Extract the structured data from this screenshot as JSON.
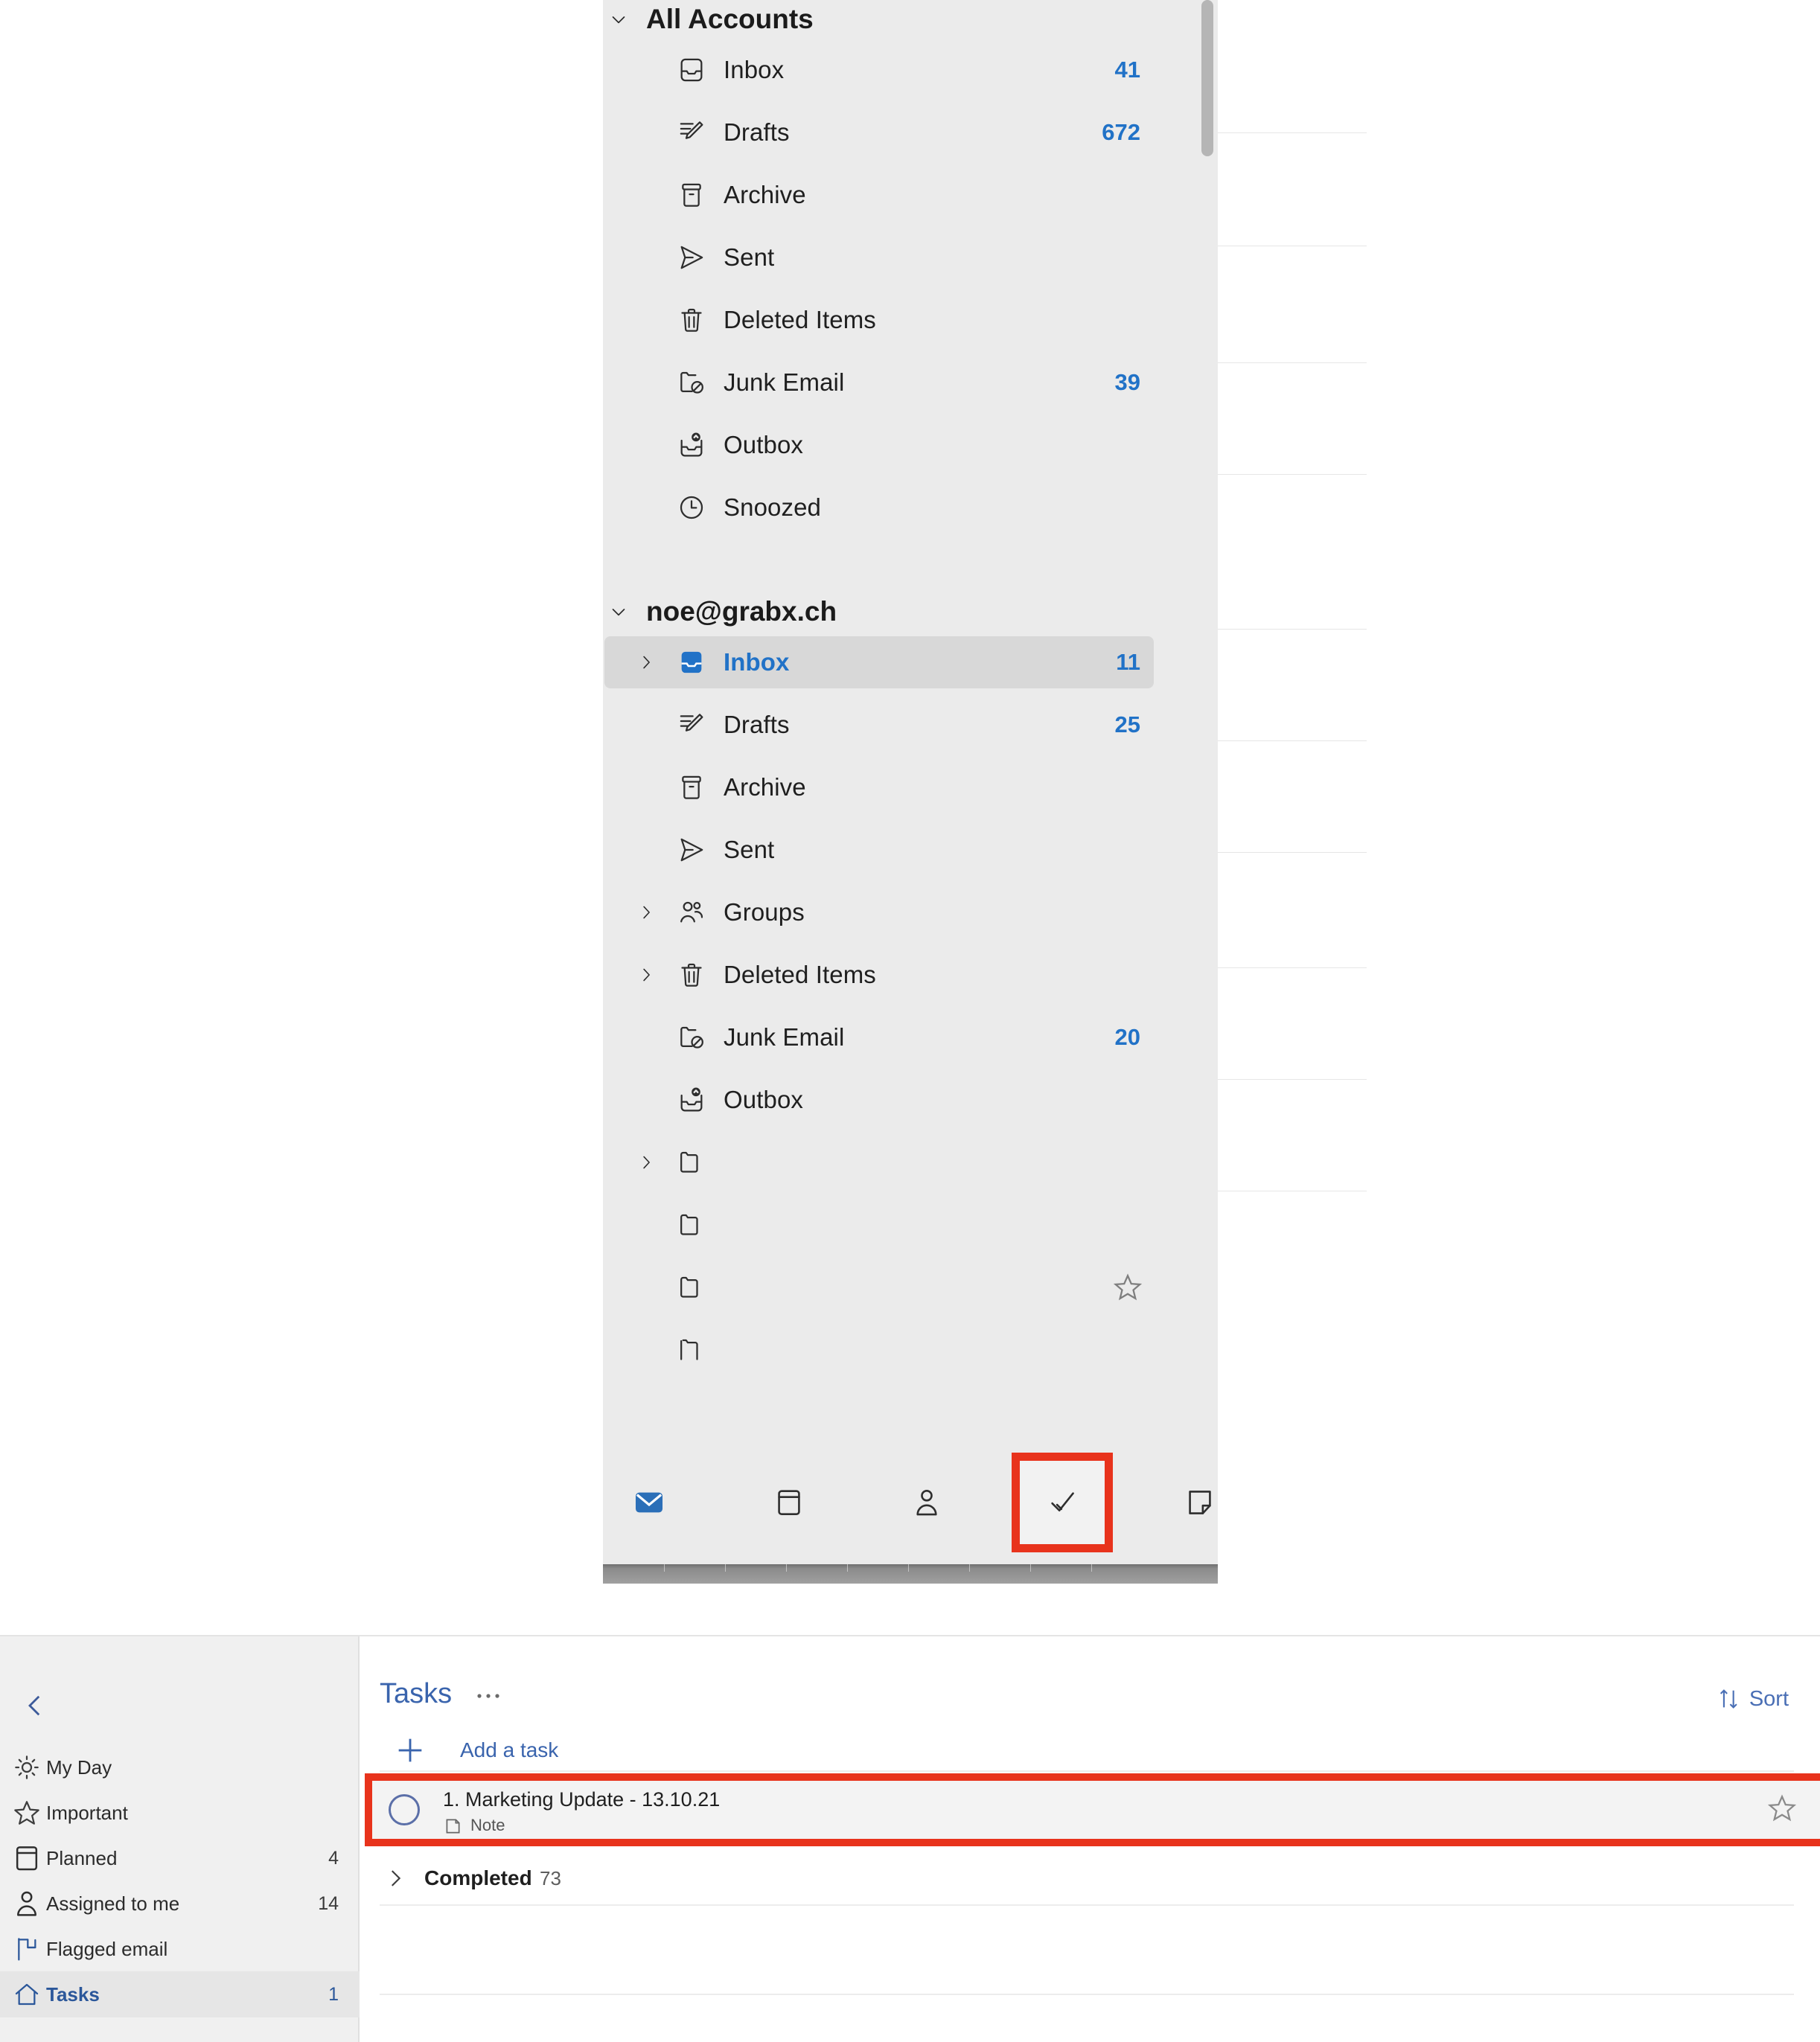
{
  "mail": {
    "accounts": [
      {
        "name": "All Accounts",
        "expand_icon": "chevron-down-icon",
        "folders": [
          {
            "label": "Inbox",
            "icon": "inbox-icon",
            "count": "41",
            "expander": false,
            "selected": false
          },
          {
            "label": "Drafts",
            "icon": "drafts-pencil-icon",
            "count": "672",
            "expander": false,
            "selected": false
          },
          {
            "label": "Archive",
            "icon": "archive-box-icon",
            "count": "",
            "expander": false,
            "selected": false
          },
          {
            "label": "Sent",
            "icon": "sent-paperplane-icon",
            "count": "",
            "expander": false,
            "selected": false
          },
          {
            "label": "Deleted Items",
            "icon": "trash-icon",
            "count": "",
            "expander": false,
            "selected": false
          },
          {
            "label": "Junk Email",
            "icon": "junk-folder-blocked-icon",
            "count": "39",
            "expander": false,
            "selected": false
          },
          {
            "label": "Outbox",
            "icon": "outbox-upload-icon",
            "count": "",
            "expander": false,
            "selected": false
          },
          {
            "label": "Snoozed",
            "icon": "clock-icon",
            "count": "",
            "expander": false,
            "selected": false
          }
        ]
      },
      {
        "name": "noe@grabx.ch",
        "expand_icon": "chevron-down-icon",
        "folders": [
          {
            "label": "Inbox",
            "icon": "inbox-filled-icon",
            "count": "11",
            "expander": true,
            "selected": true
          },
          {
            "label": "Drafts",
            "icon": "drafts-pencil-icon",
            "count": "25",
            "expander": false,
            "selected": false
          },
          {
            "label": "Archive",
            "icon": "archive-box-icon",
            "count": "",
            "expander": false,
            "selected": false
          },
          {
            "label": "Sent",
            "icon": "sent-paperplane-icon",
            "count": "",
            "expander": false,
            "selected": false
          },
          {
            "label": "Groups",
            "icon": "people-group-icon",
            "count": "",
            "expander": true,
            "selected": false
          },
          {
            "label": "Deleted Items",
            "icon": "trash-icon",
            "count": "",
            "expander": true,
            "selected": false
          },
          {
            "label": "Junk Email",
            "icon": "junk-folder-blocked-icon",
            "count": "20",
            "expander": false,
            "selected": false
          },
          {
            "label": "Outbox",
            "icon": "outbox-upload-icon",
            "count": "",
            "expander": false,
            "selected": false
          },
          {
            "label": "",
            "icon": "folder-icon",
            "count": "",
            "expander": true,
            "selected": false
          },
          {
            "label": "",
            "icon": "folder-icon",
            "count": "",
            "expander": false,
            "selected": false
          },
          {
            "label": "",
            "icon": "folder-icon",
            "count": "",
            "expander": false,
            "selected": false,
            "star": true
          },
          {
            "label": "",
            "icon": "folder-partial-icon",
            "count": "",
            "expander": false,
            "selected": false
          }
        ]
      }
    ],
    "appbar": [
      {
        "name": "mail-app-button",
        "icon": "mail-filled-icon",
        "active": true,
        "highlighted": false
      },
      {
        "name": "calendar-app-button",
        "icon": "calendar-icon",
        "active": false,
        "highlighted": false
      },
      {
        "name": "people-app-button",
        "icon": "person-icon",
        "active": false,
        "highlighted": false
      },
      {
        "name": "tasks-app-button",
        "icon": "checkmark-icon",
        "active": false,
        "highlighted": true
      },
      {
        "name": "notes-app-button",
        "icon": "note-icon",
        "active": false,
        "highlighted": false
      }
    ]
  },
  "tasks": {
    "sidebar": {
      "back_icon": "chevron-left-icon",
      "items": [
        {
          "label": "My Day",
          "icon": "sun-icon",
          "count": "",
          "active": false
        },
        {
          "label": "Important",
          "icon": "star-icon",
          "count": "",
          "active": false
        },
        {
          "label": "Planned",
          "icon": "calendar-icon",
          "count": "4",
          "active": false
        },
        {
          "label": "Assigned to me",
          "icon": "person-icon",
          "count": "14",
          "active": false
        },
        {
          "label": "Flagged email",
          "icon": "flag-icon",
          "count": "",
          "active": false
        },
        {
          "label": "Tasks",
          "icon": "home-icon",
          "count": "1",
          "active": true
        }
      ]
    },
    "main": {
      "title": "Tasks",
      "more_icon": "ellipsis-icon",
      "sort_label": "Sort",
      "sort_icon": "sort-arrows-icon",
      "add_task_label": "Add a task",
      "add_task_icon": "plus-icon",
      "task": {
        "title": "1. Marketing Update - 13.10.21",
        "note_label": "Note",
        "note_icon": "note-small-icon",
        "complete_icon": "circle-icon",
        "star_icon": "star-outline-icon"
      },
      "completed": {
        "label": "Completed",
        "count": "73",
        "expand_icon": "chevron-right-icon"
      }
    }
  },
  "colors": {
    "accent_blue": "#2172c7",
    "link_blue": "#3a64ad",
    "highlight_red": "#e8331c",
    "pane_bg": "#ebebeb",
    "selected_bg": "#d8d8d8"
  }
}
